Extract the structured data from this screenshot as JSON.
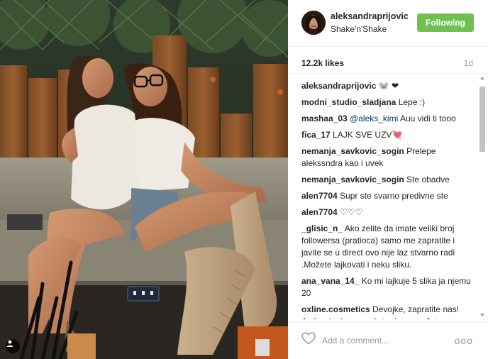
{
  "post": {
    "username": "aleksandraprijovic",
    "location": "Shake'n'Shake",
    "follow_label": "Following",
    "likes": "12.2k likes",
    "time": "1d"
  },
  "comments": [
    {
      "user": "aleksandraprijovic",
      "text": "🐭 ❤"
    },
    {
      "user": "modni_studio_sladjana",
      "text": "Lepe :)"
    },
    {
      "user": "mashaa_03",
      "mention": "@aleks_kimi",
      "text": "Auu vidi ti tooo"
    },
    {
      "user": "fica_17",
      "text": "LAJK SVE UZV💘"
    },
    {
      "user": "nemanja_savkovic_sogin",
      "text": "Prelepe alekssndra kao i uvek"
    },
    {
      "user": "nemanja_savkovic_sogin",
      "text": "Ste obadve"
    },
    {
      "user": "alen7704",
      "text": "Supr ste svarno predivne ste"
    },
    {
      "user": "alen7704",
      "text": "♡♡♡"
    },
    {
      "user": "_glisic_n_",
      "text": "Ako zelite da imate veliki broj followersa (pratioca) samo me zapratite i javite se u direct ovo nije laz stvarno radi .Možete lajkovati i neku sliku."
    },
    {
      "user": "ana_vana_14_",
      "text": "Ko mi lajkuje 5 slika ja njemu 20"
    },
    {
      "user": "oxline.cosmetics",
      "text": "Devojke, zapratite nas! Jedino kod nas možete da pronađete ORIGINALNU šminku po veoma"
    }
  ],
  "footer": {
    "placeholder": "Add a comment...",
    "more": "ooo"
  },
  "icons": {
    "heart": "heart-icon",
    "tag": "person-tag-icon",
    "more": "more-options-icon"
  },
  "colors": {
    "follow_button": "#70c050",
    "mention": "#003569",
    "muted": "#999999"
  }
}
